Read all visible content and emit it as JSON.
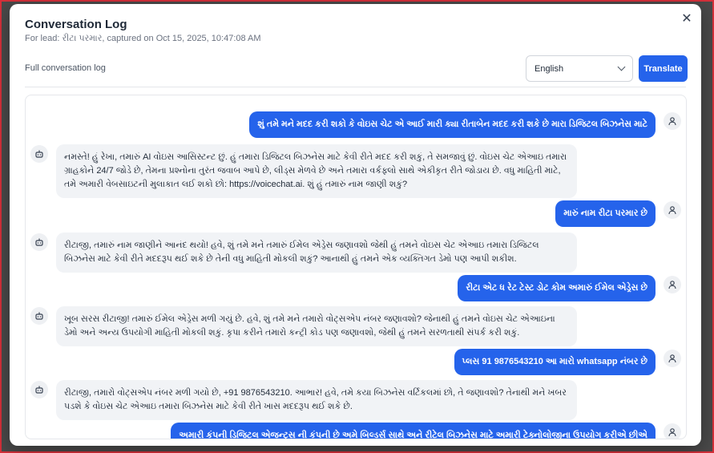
{
  "modal": {
    "title": "Conversation Log",
    "subtitle": "For lead: રીટા પરમાર, captured on Oct 15, 2025, 10:47:08 AM",
    "close_icon": "close-icon"
  },
  "toolbar": {
    "label": "Full conversation log",
    "language": "English",
    "translate_label": "Translate"
  },
  "messages": [
    {
      "role": "user",
      "text": "શું તમે મને મદદ કરી શકો કે વોઇસ ચેટ એ આઈ મારી ક્યા રીતાબેન મદદ કરી શકે છે મારા ડિજિટલ બિઝનેસ માટે"
    },
    {
      "role": "ai",
      "text": "નમસ્તે! હું રેખા, તમારું AI વોઇસ આસિસ્ટન્ટ છું. હું તમારા ડિજિટલ બિઝનેસ માટે કેવી રીતે મદદ કરી શકું, તે સમજાવું છું. વોઇસ ચેટ એઆઇ તમારા ગ્રાહકોને 24/7 જોડે છે, તેમના પ્રશ્નોના તુરંત જવાબ આપે છે, લીડ્સ મેળવે છે અને તમારા વર્કફ્લો સાથે એકીકૃત રીતે જોડાય છે. વધુ માહિતી માટે, તમે અમારી વેબસાઇટની મુલાકાત લઈ શકો છો: https://voicechat.ai. શું હું તમારું નામ જાણી શકું?"
    },
    {
      "role": "user",
      "text": "મારું નામ રીટા પરમાર છે"
    },
    {
      "role": "ai",
      "text": "રીટાજી, તમારું નામ જાણીને આનંદ થયો! હવે, શું તમે મને તમારું ઈમેલ એડ્રેસ જણાવશો જેથી હું તમને વોઇસ ચેટ એઆઇ તમારા ડિજિટલ બિઝનેસ માટે કેવી રીતે મદદરૂપ થઈ શકે છે તેની વધુ માહિતી મોકલી શકું? આનાથી હું તમને એક વ્યક્તિગત ડેમો પણ આપી શકીશ."
    },
    {
      "role": "user",
      "text": "રીટા એટ ધ રેટ ટેસ્ટ ડોટ કોમ અમારું ઈમેલ એડ્રેસ છે"
    },
    {
      "role": "ai",
      "text": "ખૂબ સરસ રીટાજી! તમારું ઈમેલ એડ્રેસ મળી ગયું છે. હવે, શું તમે મને તમારો વોટ્સએપ નંબર જણાવશો? જેનાથી હું તમને વોઇસ ચેટ એઆઇના ડેમો અને અન્ય ઉપયોગી માહિતી મોકલી શકું. કૃપા કરીને તમારો કન્ટ્રી કોડ પણ જણાવશો, જેથી હું તમને સરળતાથી સંપર્ક કરી શકું."
    },
    {
      "role": "user",
      "text": "પ્લસ 91 9876543210 આ મારો whatsapp નંબર છે"
    },
    {
      "role": "ai",
      "text": "રીટાજી, તમારો વોટ્સએપ નંબર મળી ગયો છે, +91 9876543210. આભાર! હવે, તમે કયા બિઝનેસ વર્ટિકલમાં છો, તે જણાવશો? તેનાથી મને ખબર પડશે કે વોઇસ ચેટ એઆઇ તમારા બિઝનેસ માટે કેવી રીતે ખાસ મદદરૂપ થઈ શકે છે."
    },
    {
      "role": "user",
      "text": "અમારી કંપની ડિજિટલ એજન્ટ્સ ની કંપની છે અમે બિલ્ડર્સ સાથે અને રીટેલ બિઝનેસ માટે અમારી ટેક્નોલોજીના ઉપયોગ કરીએ છીએ"
    }
  ],
  "icons": {
    "user": "user-icon",
    "ai": "bot-icon"
  },
  "colors": {
    "accent": "#2563eb",
    "ai_bubble": "#f1f3f6"
  }
}
